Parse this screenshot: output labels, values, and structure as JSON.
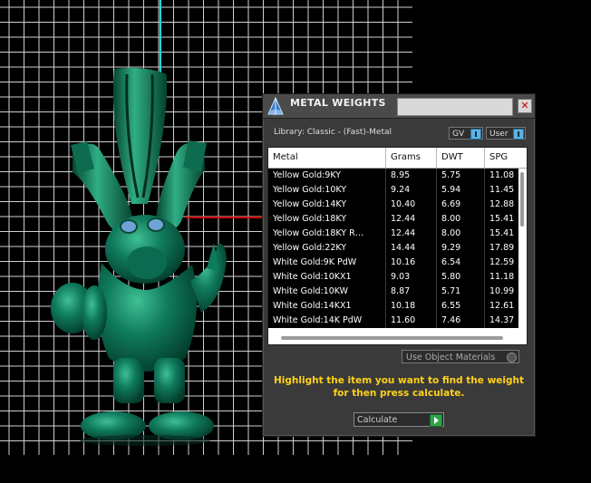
{
  "window": {
    "title": "METAL WEIGHTS",
    "close_label": "✕"
  },
  "library_label": "Library: Classic - (Fast)-Metal",
  "toggles": {
    "gv": "GV",
    "user": "User"
  },
  "table": {
    "columns": [
      "Metal",
      "Grams",
      "DWT",
      "SPG"
    ],
    "rows": [
      [
        "Yellow Gold:9KY",
        "8.95",
        "5.75",
        "11.08"
      ],
      [
        "Yellow Gold:10KY",
        "9.24",
        "5.94",
        "11.45"
      ],
      [
        "Yellow Gold:14KY",
        "10.40",
        "6.69",
        "12.88"
      ],
      [
        "Yellow Gold:18KY",
        "12.44",
        "8.00",
        "15.41"
      ],
      [
        "Yellow Gold:18KY R…",
        "12.44",
        "8.00",
        "15.41"
      ],
      [
        "Yellow Gold:22KY",
        "14.44",
        "9.29",
        "17.89"
      ],
      [
        "White Gold:9K PdW",
        "10.16",
        "6.54",
        "12.59"
      ],
      [
        "White Gold:10KX1",
        "9.03",
        "5.80",
        "11.18"
      ],
      [
        "White Gold:10KW",
        "8.87",
        "5.71",
        "10.99"
      ],
      [
        "White Gold:14KX1",
        "10.18",
        "6.55",
        "12.61"
      ],
      [
        "White Gold:14K PdW",
        "11.60",
        "7.46",
        "14.37"
      ]
    ]
  },
  "use_object_materials": "Use Object Materials",
  "instructions": "Highlight the item you want to find the weight for then press calculate.",
  "calculate_label": "Calculate",
  "colors": {
    "model": "#0e6e55",
    "grid": "#d8d8d8",
    "axis_red": "#cc0000",
    "axis_cyan": "#2ad0d8",
    "highlight_text": "#ffd21a"
  },
  "icons": [
    "metal-weights-app-icon",
    "close-icon",
    "toggle-icon",
    "calculate-go-icon"
  ]
}
